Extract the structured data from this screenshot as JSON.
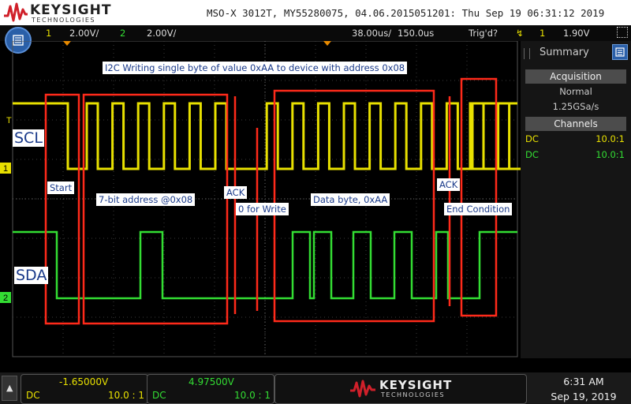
{
  "header": {
    "brand": "KEYSIGHT",
    "brand_sub": "TECHNOLOGIES",
    "title": "MSO-X 3012T, MY55280075, 04.06.2015051201: Thu Sep 19 06:31:12 2019"
  },
  "menubar": {
    "ch1_num": "1",
    "ch1_scale": "2.00V/",
    "ch2_num": "2",
    "ch2_scale": "2.00V/",
    "timebase": "38.00us/",
    "delay": "150.0us",
    "trig_status": "Trig'd?",
    "trig_ch": "1",
    "trig_level": "1.90V"
  },
  "sidebar": {
    "title": "Summary",
    "acq_head": "Acquisition",
    "acq_mode": "Normal",
    "acq_rate": "1.25GSa/s",
    "chan_head": "Channels",
    "rows": [
      {
        "coupling": "DC",
        "probe": "10.0:1",
        "color": "#e8e000"
      },
      {
        "coupling": "DC",
        "probe": "10.0:1",
        "color": "#33dd33"
      }
    ]
  },
  "annotations": {
    "title": "I2C Writing single byte of value 0xAA to device with address 0x08",
    "scl": "SCL",
    "sda": "SDA",
    "start": "Start",
    "address": "7-bit address @0x08",
    "ack1": "ACK",
    "write": "0 for Write",
    "data": "Data byte, 0xAA",
    "ack2": "ACK",
    "end": "End Condition"
  },
  "markers": {
    "trig_marker": "T",
    "ch1_ground": "1",
    "ch2_ground": "2"
  },
  "bottom": {
    "ch1_offset": "-1.65000V",
    "ch1_coupling": "DC",
    "ch1_probe": "10.0 : 1",
    "ch2_offset": "4.97500V",
    "ch2_coupling": "DC",
    "ch2_probe": "10.0 : 1",
    "brand": "KEYSIGHT",
    "brand_sub": "TECHNOLOGIES",
    "time": "6:31 AM",
    "date": "Sep 19, 2019"
  },
  "colors": {
    "ch1": "#e8e000",
    "ch2": "#33dd33",
    "annotation_box": "#ff2a1a",
    "brand_red": "#d0202a"
  }
}
